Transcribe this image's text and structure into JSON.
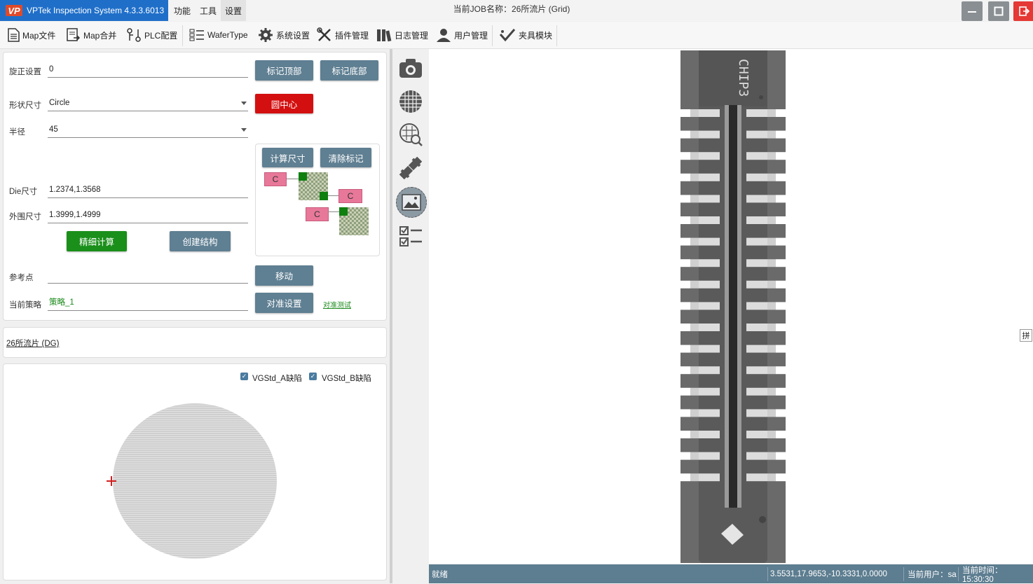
{
  "titlebar": {
    "app_title": "VPTek Inspection System 4.3.3.6013",
    "logo_text": "VP",
    "menus": [
      "功能",
      "工具",
      "设置"
    ],
    "job_label": "当前JOB名称：26所流片 (Grid)"
  },
  "toolbar": {
    "items": [
      "Map文件",
      "Map合并",
      "PLC配置",
      "WaferType",
      "系统设置",
      "插件管理",
      "日志管理",
      "用户管理",
      "夹具模块"
    ]
  },
  "settings": {
    "rotation_label": "旋正设置",
    "rotation_value": "0",
    "mark_top": "标记顶部",
    "mark_bottom": "标记底部",
    "shape_label": "形状尺寸",
    "shape_value": "Circle",
    "circle_center": "圆中心",
    "radius_label": "半径",
    "radius_value": "45",
    "calc_size": "计算尺寸",
    "clear_marks": "清除标记",
    "c_label": "C",
    "die_label": "Die尺寸",
    "die_value": "1.2374,1.3568",
    "outer_label": "外围尺寸",
    "outer_value": "1.3999,1.4999",
    "fine_calc": "精细计算",
    "create_struct": "创建结构",
    "ref_label": "参考点",
    "ref_value": "",
    "move": "移动",
    "strategy_label": "当前策略",
    "strategy_value": "策略_1",
    "align_settings": "对准设置",
    "align_test": "对准测试"
  },
  "product": {
    "name": "26所流片 (DG)"
  },
  "defects": {
    "items": [
      {
        "label": "VGStd_A缺陷",
        "checked": true
      },
      {
        "label": "VGStd_B缺陷",
        "checked": true
      }
    ]
  },
  "side_icons": [
    "camera-icon",
    "wafer-grid-icon",
    "wafer-zoom-icon",
    "ruler-icon",
    "image-icon",
    "checklist-icon"
  ],
  "image": {
    "chip_label": "CHIP3",
    "grid_toggle": "拼"
  },
  "status": {
    "state": "就绪",
    "coords": "3.5531,17.9653,-10.3331,0.0000",
    "user": "当前用户：sa",
    "time": "当前时间：15:30:30"
  },
  "colors": {
    "accent": "#1f6fc9",
    "button": "#5f7f92",
    "danger": "#d40f0f",
    "ok": "#1a8f1a",
    "status": "#5d7d90"
  }
}
